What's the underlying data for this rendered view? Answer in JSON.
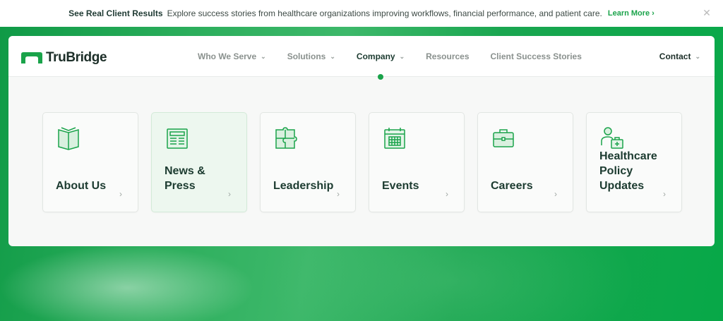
{
  "promo": {
    "title": "See Real Client Results",
    "text": "Explore success stories from healthcare organizations improving workflows, financial performance, and patient care.",
    "link": "Learn More",
    "link_chevron": "›",
    "close": "✕"
  },
  "brand": {
    "name": "TruBridge",
    "color": "#1aa34a"
  },
  "menu": {
    "items": [
      {
        "label": "Who We Serve",
        "chevron": "⌄"
      },
      {
        "label": "Solutions",
        "chevron": "⌄"
      },
      {
        "label": "Company",
        "chevron": "⌄",
        "active": true
      },
      {
        "label": "Resources",
        "chevron": ""
      },
      {
        "label": "Client Success Stories",
        "chevron": ""
      }
    ],
    "contact": "Contact",
    "contact_chevron": "⌄"
  },
  "cards": [
    {
      "label": "About Us",
      "icon": "book-icon",
      "arrow": "›"
    },
    {
      "label": "News & Press",
      "icon": "newspaper-icon",
      "arrow": "›",
      "highlighted": true
    },
    {
      "label": "Leadership",
      "icon": "puzzle-icon",
      "arrow": "›"
    },
    {
      "label": "Events",
      "icon": "calendar-icon",
      "arrow": "›"
    },
    {
      "label": "Careers",
      "icon": "briefcase-icon",
      "arrow": "›"
    },
    {
      "label": "Healthcare Policy Updates",
      "icon": "doctor-icon",
      "arrow": "›"
    }
  ]
}
